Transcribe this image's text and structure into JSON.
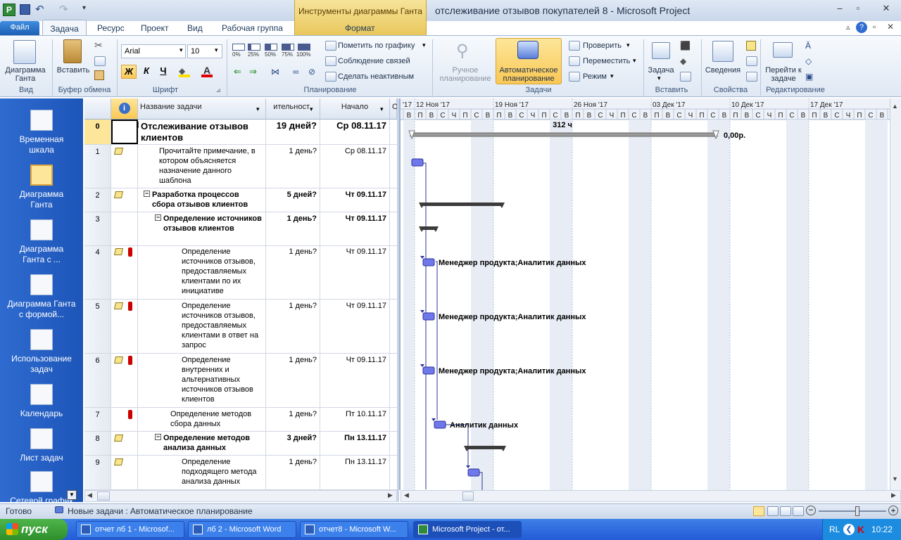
{
  "window": {
    "title": "отслеживание отзывов покупателей 8  -  Microsoft Project",
    "context_tab_group": "Инструменты диаграммы Ганта"
  },
  "tabs": {
    "file": "Файл",
    "task": "Задача",
    "resource": "Ресурс",
    "project": "Проект",
    "view": "Вид",
    "team": "Рабочая группа",
    "format": "Формат"
  },
  "ribbon": {
    "gantt_chart": "Диаграмма Ганта",
    "view_group": "Вид",
    "paste": "Вставить",
    "clipboard_group": "Буфер обмена",
    "font_name": "Arial",
    "font_size": "10",
    "bold": "Ж",
    "italic": "К",
    "underline": "Ч",
    "font_group": "Шрифт",
    "pct": [
      "0%",
      "25%",
      "50%",
      "75%",
      "100%"
    ],
    "mark_on_track": "Пометить по графику",
    "respect_links": "Соблюдение связей",
    "inactivate": "Сделать неактивным",
    "schedule_group": "Планирование",
    "manual_schedule": "Ручное планирование",
    "auto_schedule": "Автоматическое планирование",
    "inspect": "Проверить",
    "move": "Переместить",
    "mode": "Режим",
    "tasks_group": "Задачи",
    "task_insert": "Задача",
    "insert_group": "Вставить",
    "information": "Сведения",
    "properties_group": "Свойства",
    "scroll_to_task": "Перейти к задаче",
    "editing_group": "Редактирование"
  },
  "views": [
    "Временная шкала",
    "Диаграмма Ганта",
    "Диаграмма Ганта с ...",
    "Диаграмма Ганта с формой...",
    "Использование задач",
    "Календарь",
    "Лист задач",
    "Сетевой график"
  ],
  "grid": {
    "headers": {
      "info": "i",
      "name": "Название задачи",
      "duration": "ительност",
      "start": "Начало",
      "next": "О"
    },
    "rows": [
      {
        "id": "0",
        "name": "Отслеживание отзывов клиентов",
        "duration": "19 дней?",
        "start": "Ср 08.11.17",
        "summary": true,
        "level": 0
      },
      {
        "id": "1",
        "name": "Прочитайте примечание, в котором объясняется назначение данного шаблона",
        "duration": "1 день?",
        "start": "Ср 08.11.17",
        "summary": false,
        "level": 1,
        "note": true
      },
      {
        "id": "2",
        "name": "Разработка процессов сбора отзывов клиентов",
        "duration": "5 дней?",
        "start": "Чт 09.11.17",
        "summary": true,
        "level": 1,
        "note": true
      },
      {
        "id": "3",
        "name": "Определение источников отзывов клиентов",
        "duration": "1 день?",
        "start": "Чт 09.11.17",
        "summary": true,
        "level": 2
      },
      {
        "id": "4",
        "name": "Определение источников отзывов, предоставляемых клиентами по их инициативе",
        "duration": "1 день?",
        "start": "Чт 09.11.17",
        "summary": false,
        "level": 3,
        "note": true,
        "res": true
      },
      {
        "id": "5",
        "name": "Определение источников отзывов, предоставляемых клиентами в ответ на запрос",
        "duration": "1 день?",
        "start": "Чт 09.11.17",
        "summary": false,
        "level": 3,
        "note": true,
        "res": true
      },
      {
        "id": "6",
        "name": "Определение внутренних и альтернативных источников отзывов клиентов",
        "duration": "1 день?",
        "start": "Чт 09.11.17",
        "summary": false,
        "level": 3,
        "note": true,
        "res": true
      },
      {
        "id": "7",
        "name": "Определение методов сбора данных",
        "duration": "1 день?",
        "start": "Пт 10.11.17",
        "summary": false,
        "level": 2,
        "res": true
      },
      {
        "id": "8",
        "name": "Определение методов анализа данных",
        "duration": "3 дней?",
        "start": "Пн 13.11.17",
        "summary": true,
        "level": 2,
        "note": true
      },
      {
        "id": "9",
        "name": "Определение подходящего метода анализа данных",
        "duration": "1 день?",
        "start": "Пн 13.11.17",
        "summary": false,
        "level": 3,
        "note": true
      }
    ]
  },
  "gantt": {
    "weeks": [
      "'17",
      "12 Ноя '17",
      "19 Ноя '17",
      "26 Ноя '17",
      "03 Дек '17",
      "10 Дек '17",
      "17 Дек '17"
    ],
    "days": [
      "В",
      "П",
      "В",
      "С",
      "Ч",
      "П",
      "С"
    ],
    "summary_work": "312 ч",
    "summary_cost": "0,00р.",
    "labels": {
      "r4": "Менеджер продукта;Аналитик данных",
      "r5": "Менеджер продукта;Аналитик данных",
      "r6": "Менеджер продукта;Аналитик данных",
      "r7": "Аналитик данных"
    }
  },
  "status": {
    "ready": "Готово",
    "new_tasks": "Новые задачи : Автоматическое планирование"
  },
  "taskbar": {
    "start": "пуск",
    "items": [
      "отчет лб 1 - Microsof...",
      "лб 2 - Microsoft Word",
      "отчет8 - Microsoft W...",
      "Microsoft Project - от..."
    ],
    "lang": "RL",
    "time": "10:22"
  }
}
